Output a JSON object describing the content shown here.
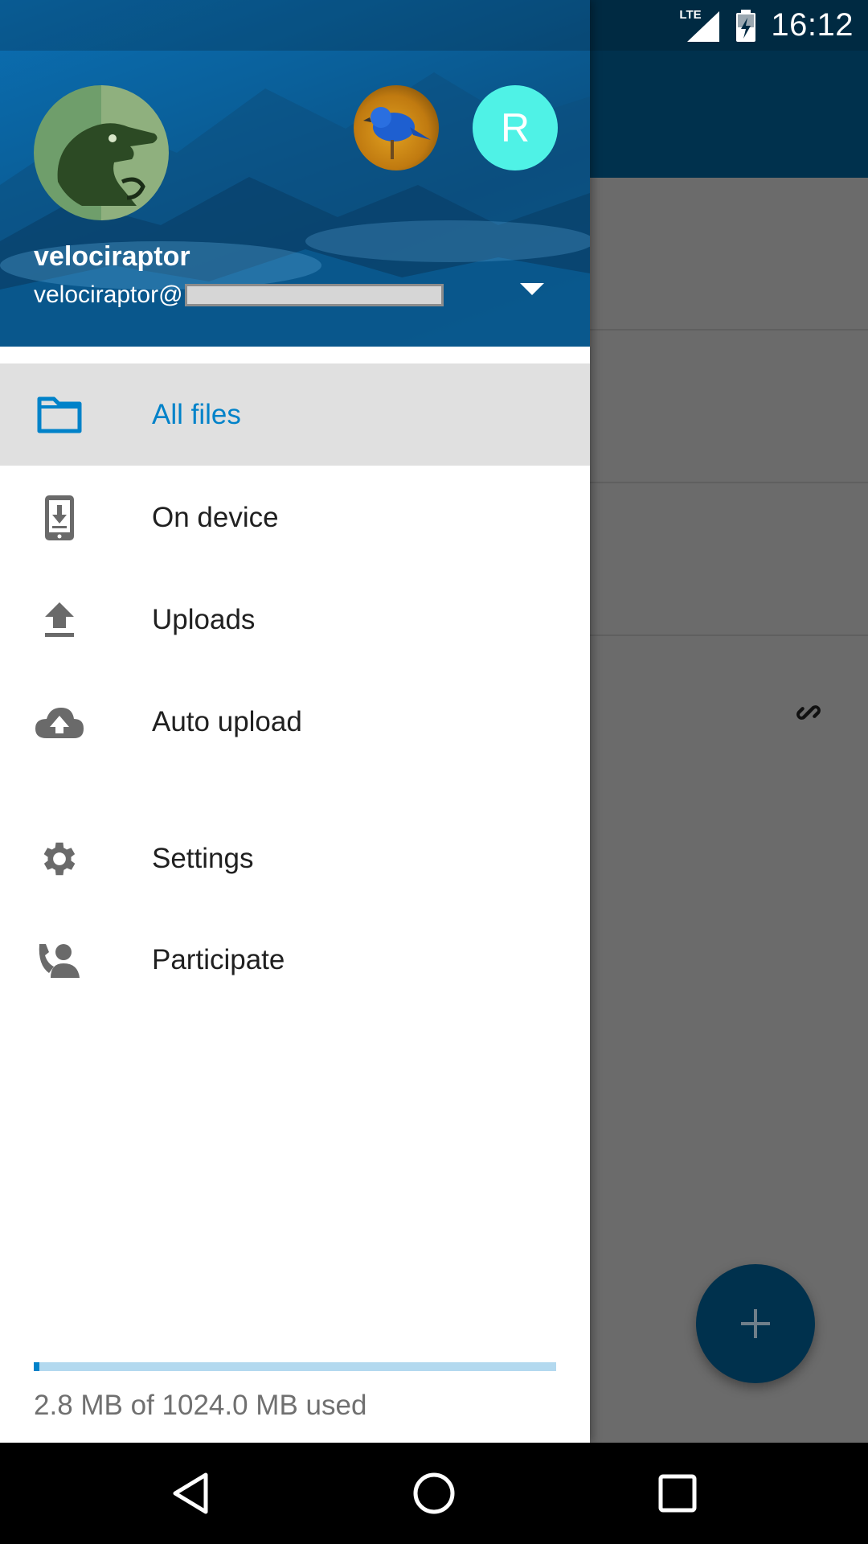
{
  "status_bar": {
    "time": "16:12",
    "network_label": "LTE",
    "icons": [
      "lte-signal-icon",
      "battery-charging-icon"
    ]
  },
  "drawer": {
    "account": {
      "name": "velociraptor",
      "email_prefix": "velociraptor@",
      "other_accounts": [
        {
          "type": "avatar-image",
          "icon": "bird-avatar-icon"
        },
        {
          "type": "initial",
          "initial": "R",
          "color": "#4ff2e6"
        }
      ]
    },
    "menu": [
      {
        "label": "All files",
        "icon": "folder-icon",
        "active": true
      },
      {
        "label": "On device",
        "icon": "phone-download-icon",
        "active": false
      },
      {
        "label": "Uploads",
        "icon": "upload-icon",
        "active": false
      },
      {
        "label": "Auto upload",
        "icon": "cloud-upload-icon",
        "active": false
      },
      {
        "label": "Settings",
        "icon": "gear-icon",
        "active": false
      },
      {
        "label": "Participate",
        "icon": "participate-icon",
        "active": false
      }
    ],
    "quota": {
      "text": "2.8 MB of 1024.0 MB used",
      "used_fraction": 0.0027
    }
  },
  "colors": {
    "accent": "#0082c9",
    "header_blue": "#0a5f99",
    "fab": "#00314d",
    "active_item_bg": "#e0e0e0"
  },
  "navigation": [
    "back-icon",
    "home-icon",
    "recents-icon"
  ]
}
